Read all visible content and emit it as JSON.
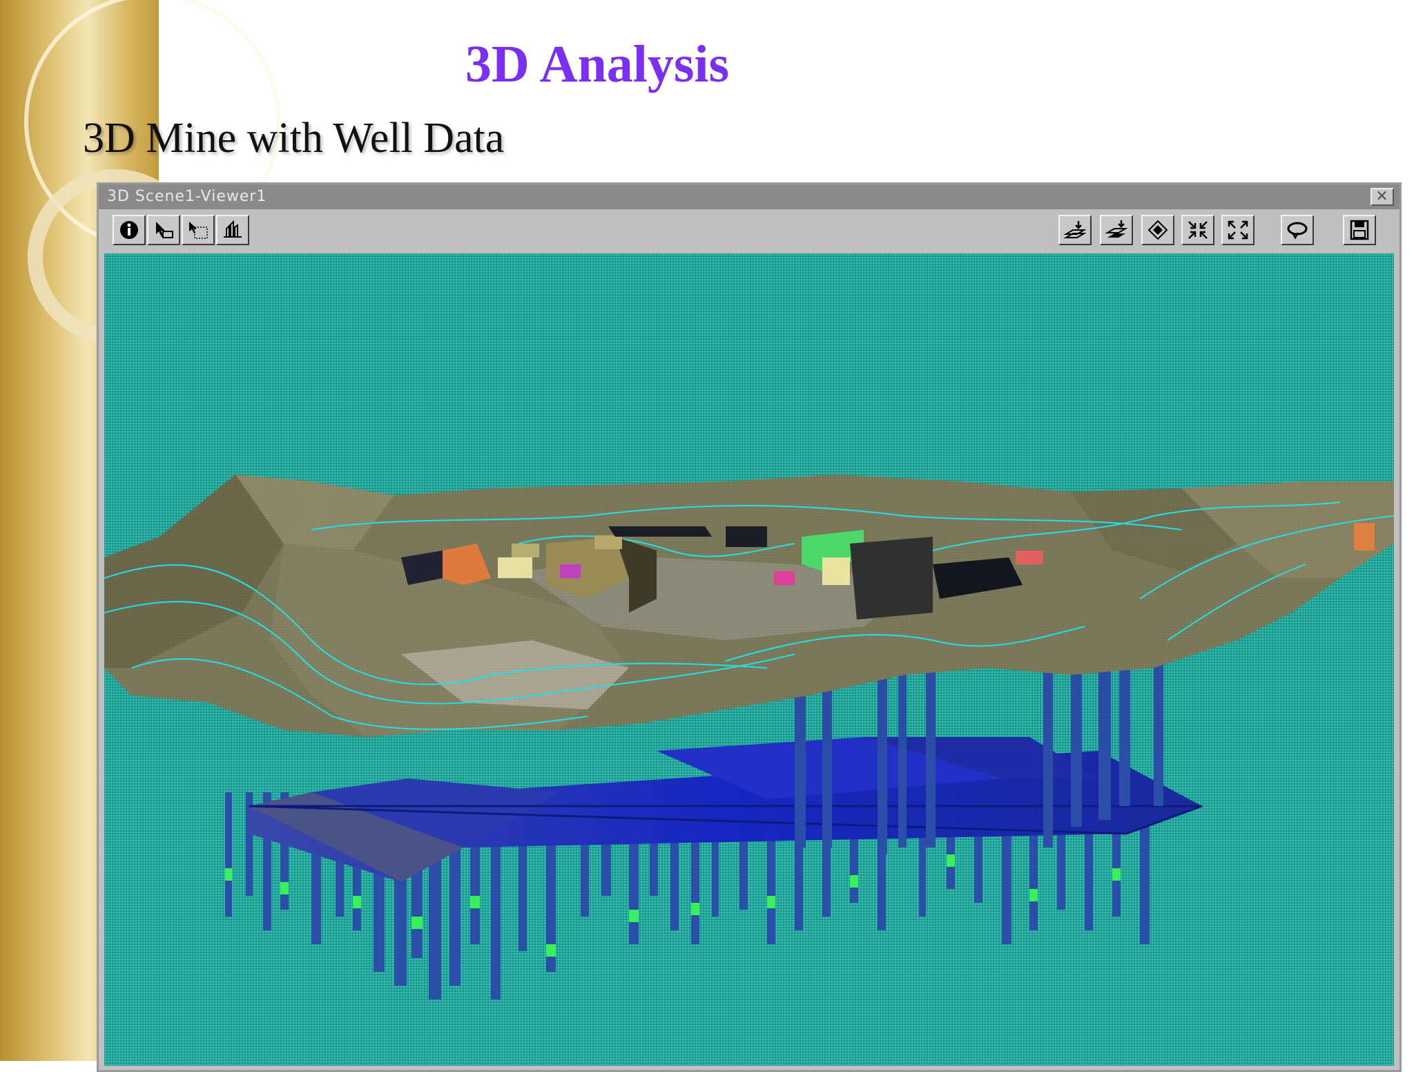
{
  "slide": {
    "title": "3D Analysis",
    "subtitle": "3D Mine with Well Data"
  },
  "window": {
    "title": "3D Scene1-Viewer1",
    "close_label": "×"
  },
  "toolbar": {
    "left_tools": [
      {
        "icon": "info-icon"
      },
      {
        "icon": "select-pointer-icon"
      },
      {
        "icon": "select-elements-icon"
      },
      {
        "icon": "navigate-icon"
      }
    ],
    "right_tools": [
      {
        "icon": "add-layer-icon"
      },
      {
        "icon": "add-surface-icon"
      },
      {
        "icon": "rotate-layer-icon"
      },
      {
        "icon": "zoom-in-extent-icon"
      },
      {
        "icon": "full-extent-icon"
      },
      {
        "icon": "rotate-view-icon"
      },
      {
        "icon": "save-icon"
      }
    ]
  },
  "colors": {
    "title": "#7b2ff2",
    "viewport_bg": "#22a89c",
    "terrain": "#7d7a5e",
    "wells": "#2b4fa8",
    "well_marker": "#39f05a",
    "underground_plane": "#1a2fb8",
    "contour_lines": "#22e0e8"
  }
}
